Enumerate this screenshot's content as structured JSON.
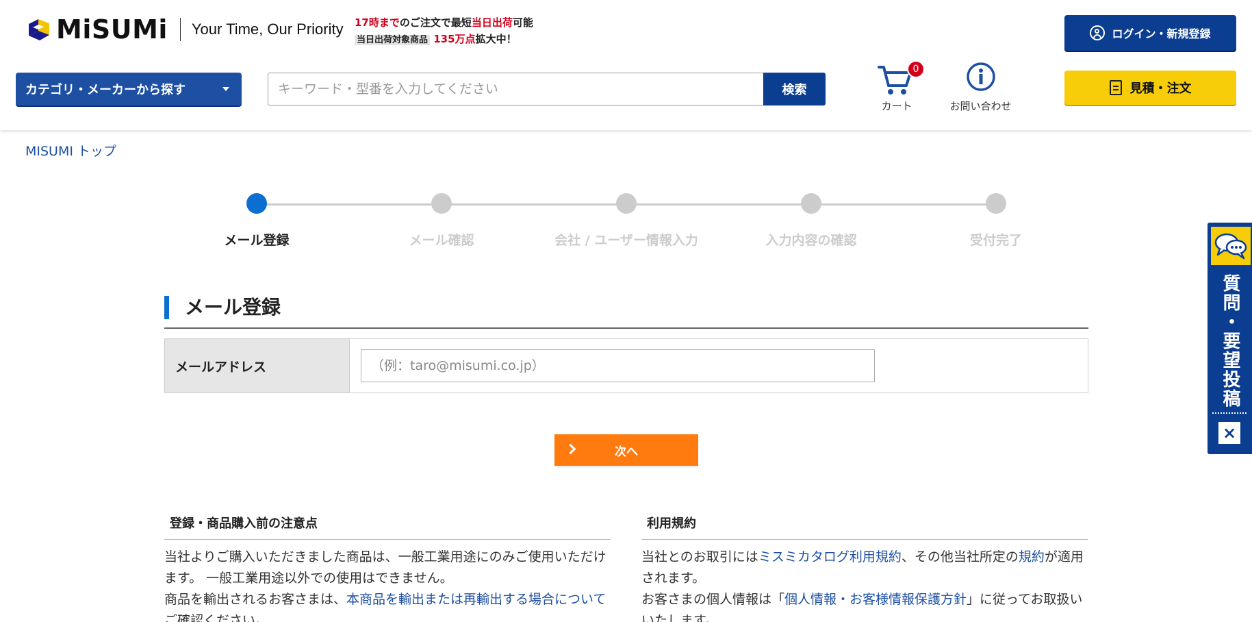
{
  "header": {
    "logo_text": "MiSUMi",
    "tagline": "Your Time, Our Priority",
    "promo": {
      "line1_red1": "17時まで",
      "line1_black1": "のご注文で最短",
      "line1_red2": "当日出荷",
      "line1_black2": "可能",
      "line2_gray": "当日出荷対象商品",
      "line2_red": "135万点",
      "line2_black": "拡大中！"
    },
    "login_label": "ログイン・新規登録",
    "category_label": "カテゴリ・メーカーから探す",
    "search_placeholder": "キーワード・型番を入力してください",
    "search_button": "検索",
    "cart_label": "カート",
    "cart_count": "0",
    "contact_label": "お問い合わせ",
    "quote_label": "見積・注文"
  },
  "breadcrumb": {
    "top": "MISUMI トップ"
  },
  "steps": [
    {
      "label": "メール登録",
      "active": true
    },
    {
      "label": "メール確認",
      "active": false
    },
    {
      "label": "会社 / ユーザー情報入力",
      "active": false
    },
    {
      "label": "入力内容の確認",
      "active": false
    },
    {
      "label": "受付完了",
      "active": false
    }
  ],
  "section": {
    "title": "メール登録"
  },
  "form": {
    "email_label": "メールアドレス",
    "email_placeholder": "（例：taro@misumi.co.jp）",
    "email_value": ""
  },
  "next_button": "次へ",
  "notes": {
    "title": "登録・商品購入前の注意点",
    "p1": "当社よりご購入いただきました商品は、一般工業用途にのみご使用いただけます。 一般工業用途以外での使用はできません。",
    "p2_text": "商品を輸出されるお客さまは、",
    "p2_link": "本商品を輸出または再輸出する場合について",
    "p2_rest": "ご確認ください。"
  },
  "terms": {
    "title": "利用規約",
    "p1_a": "当社とのお取引には",
    "p1_link1": "ミスミカタログ利用規約",
    "p1_b": "、その他当社所定の",
    "p1_link2": "規約",
    "p1_c": "が適用されます。",
    "p2_a": "お客さまの個人情報は「",
    "p2_link": "個人情報・お客様情報保護方針",
    "p2_b": "」に従ってお取扱いいたします。"
  },
  "side_tab": {
    "label": "質問・要望投稿",
    "close": "×"
  },
  "colors": {
    "brand_blue": "#0b3d91",
    "accent_orange": "#ff7b0f",
    "accent_yellow": "#f7cd0a",
    "step_active": "#0a6fd1"
  }
}
